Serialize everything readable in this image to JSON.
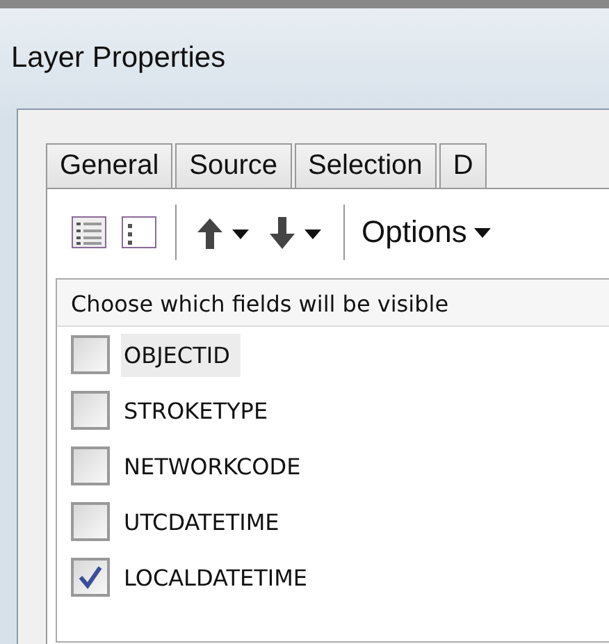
{
  "window": {
    "title": "Layer Properties"
  },
  "tabs": [
    {
      "label": "General"
    },
    {
      "label": "Source"
    },
    {
      "label": "Selection"
    },
    {
      "label": "D"
    }
  ],
  "toolbar": {
    "options_label": "Options"
  },
  "field_list": {
    "header": "Choose which fields will be visible",
    "fields": [
      {
        "name": "OBJECTID",
        "checked": false,
        "selected": true
      },
      {
        "name": "STROKETYPE",
        "checked": false,
        "selected": false
      },
      {
        "name": "NETWORKCODE",
        "checked": false,
        "selected": false
      },
      {
        "name": "UTCDATETIME",
        "checked": false,
        "selected": false
      },
      {
        "name": "LOCALDATETIME",
        "checked": true,
        "selected": false
      }
    ]
  }
}
